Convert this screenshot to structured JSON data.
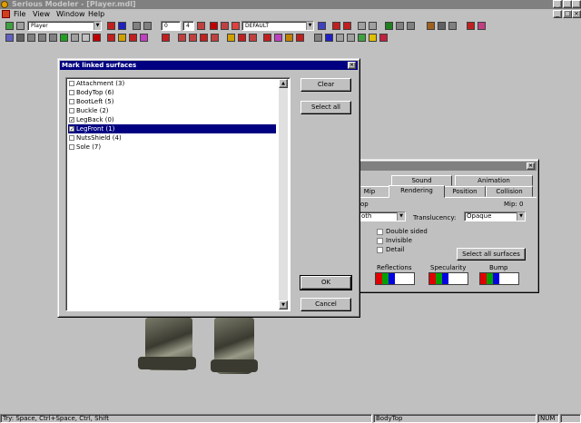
{
  "app": {
    "title": "Serious Modeler - [Player.mdl]",
    "window_controls": [
      "_",
      "□",
      "×"
    ]
  },
  "menu": [
    "File",
    "View",
    "Window",
    "Help"
  ],
  "toolbar": {
    "model_combo": "Player",
    "frame_field_1": "0",
    "frame_field_2": "4",
    "anim_combo": "DEFAULT"
  },
  "mark_dialog": {
    "title": "Mark linked surfaces",
    "close": "×",
    "items": [
      {
        "label": "Attachment (3)",
        "checked": false,
        "selected": false
      },
      {
        "label": "BodyTop (6)",
        "checked": false,
        "selected": false
      },
      {
        "label": "BootLeft (5)",
        "checked": false,
        "selected": false
      },
      {
        "label": "Buckle (2)",
        "checked": false,
        "selected": false
      },
      {
        "label": "LegBack (0)",
        "checked": true,
        "selected": false
      },
      {
        "label": "LegFront (1)",
        "checked": true,
        "selected": true
      },
      {
        "label": "NutsShield (4)",
        "checked": false,
        "selected": false
      },
      {
        "label": "Sole (7)",
        "checked": false,
        "selected": false
      }
    ],
    "check_mark": "✓",
    "clear_label": "Clear",
    "select_all_label": "Select all",
    "ok_label": "OK",
    "cancel_label": "Cancel"
  },
  "props_panel": {
    "close": "×",
    "tabs_row1": [
      "Sound",
      "Animation"
    ],
    "tabs_row2": [
      "Mip",
      "Rendering",
      "Position",
      "Collision"
    ],
    "active_tab": "Rendering",
    "surface_name": "op",
    "mip_label": "Mip: 0",
    "shading_value": "oth",
    "translucency_label": "Translucency:",
    "translucency_value": "Opaque",
    "double_sided": "Double sided",
    "invisible": "Invisible",
    "detail": "Detail",
    "select_all_surfaces": "Select all surfaces",
    "reflections_label": "Reflections",
    "specularity_label": "Specularity",
    "bump_label": "Bump"
  },
  "statusbar": {
    "hint": "Try: Space, Ctrl+Space, Ctrl, Shift",
    "surface": "BodyTop",
    "num": "NUM"
  },
  "colors": {
    "title_active": "#000080",
    "title_inactive": "#808080",
    "face": "#c0c0c0"
  }
}
